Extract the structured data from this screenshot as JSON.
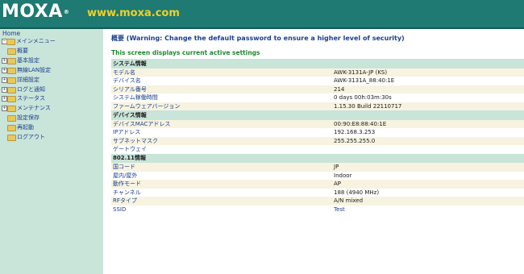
{
  "header": {
    "brand": "MOXA",
    "brand_mark": "®",
    "url": "www.moxa.com"
  },
  "sidebar": {
    "home": "Home",
    "root": "メインメニュー",
    "items": [
      {
        "label": "概要",
        "expandable": false
      },
      {
        "label": "基本設定",
        "expandable": true
      },
      {
        "label": "無線LAN設定",
        "expandable": true
      },
      {
        "label": "詳細設定",
        "expandable": true
      },
      {
        "label": "ログと通知",
        "expandable": true
      },
      {
        "label": "ステータス",
        "expandable": true
      },
      {
        "label": "メンテナンス",
        "expandable": true
      },
      {
        "label": "設定保存",
        "expandable": false
      },
      {
        "label": "再起動",
        "expandable": false
      },
      {
        "label": "ログアウト",
        "expandable": false
      }
    ]
  },
  "main": {
    "warning": "概要 (Warning: Change the default password to ensure a higher level of security)",
    "subtitle": "This screen displays current active settings",
    "sections": [
      {
        "title": "システム情報",
        "rows": [
          {
            "key": "モデル名",
            "value": "AWK-3131A-JP (KS)"
          },
          {
            "key": "デバイス名",
            "value": "AWK-3131A_88:40:1E"
          },
          {
            "key": "シリアル番号",
            "value": "214"
          },
          {
            "key": "システム稼働時間",
            "value": "0 days 00h:03m:30s"
          },
          {
            "key": "ファームウェアバージョン",
            "value": "1.15.30 Build 22110717"
          }
        ]
      },
      {
        "title": "デバイス情報",
        "rows": [
          {
            "key": "デバイスMACアドレス",
            "value": "00:90:E8:88:40:1E"
          },
          {
            "key": "IPアドレス",
            "value": "192.168.3.253"
          },
          {
            "key": "サブネットマスク",
            "value": "255.255.255.0"
          },
          {
            "key": "ゲートウェイ",
            "value": ""
          }
        ]
      },
      {
        "title": "802.11情報",
        "rows": [
          {
            "key": "国コード",
            "value": "JP"
          },
          {
            "key": "屋内/屋外",
            "value": "Indoor"
          },
          {
            "key": "動作モード",
            "value": "AP"
          },
          {
            "key": "チャンネル",
            "value": "188 (4940 MHz)"
          },
          {
            "key": "RFタイプ",
            "value": "A/N mixed"
          },
          {
            "key": "SSID",
            "value": "Test"
          }
        ]
      }
    ]
  }
}
